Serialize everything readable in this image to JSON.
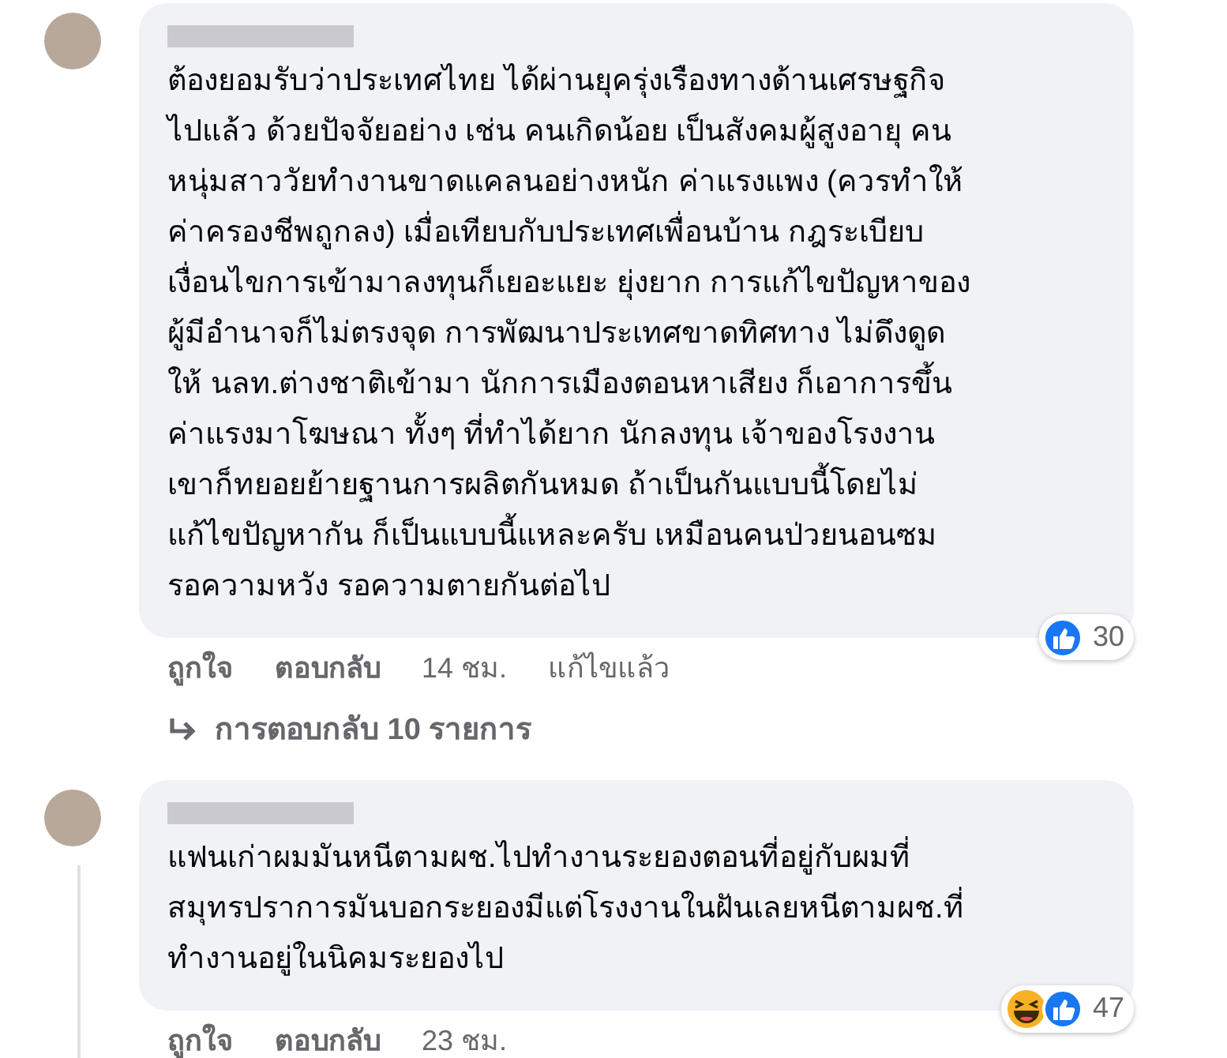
{
  "comments": [
    {
      "text_lines": [
        "ต้องยอมรับว่าประเทศไทย ได้ผ่านยุครุ่งเรืองทางด้านเศรษฐกิจ",
        "ไปแล้ว ด้วยปัจจัยอย่าง เช่น คนเกิดน้อย เป็นสังคมผู้สูงอายุ คน",
        "หนุ่มสาววัยทำงานขาดแคลนอย่างหนัก ค่าแรงแพง (ควรทำให้",
        "ค่าครองชีพถูกลง) เมื่อเทียบกับประเทศเพื่อนบ้าน กฎระเบียบ",
        "เงื่อนไขการเข้ามาลงทุนก็เยอะแยะ ยุ่งยาก การแก้ไขปัญหาของ",
        "ผู้มีอำนาจก็ไม่ตรงจุด การพัฒนาประเทศขาดทิศทาง ไม่ดึงดูด",
        "ให้ นลท.ต่างชาติเข้ามา นักการเมืองตอนหาเสียง ก็เอาการขึ้น",
        "ค่าแรงมาโฆษณา ทั้งๆ ที่ทำได้ยาก นักลงทุน เจ้าของโรงงาน",
        "เขาก็ทยอยย้ายฐานการผลิตกันหมด ถ้าเป็นกันแบบนี้โดยไม่",
        "แก้ไขปัญหากัน ก็เป็นแบบนี้แหละครับ เหมือนคนป่วยนอนซม",
        "รอความหวัง รอความตายกันต่อไป"
      ],
      "reactions": [
        {
          "kind": "like"
        }
      ],
      "reaction_count": "30",
      "actions": [
        "ถูกใจ",
        "ตอบกลับ"
      ],
      "time": "14 ชม.",
      "edited_label": "แก้ไขแล้ว",
      "replies_link": "การตอบกลับ 10 รายการ"
    },
    {
      "text_lines": [
        "แฟนเก่าผมมันหนีตามผช.ไปทำงานระยองตอนที่อยู่กับผมที่",
        "สมุทรปราการมันบอกระยองมีแต่โรงงานในฝันเลยหนีตามผช.ที่",
        "ทำงานอยู่ในนิคมระยองไป"
      ],
      "reactions": [
        {
          "kind": "haha"
        },
        {
          "kind": "like"
        }
      ],
      "reaction_count": "47",
      "actions": [
        "ถูกใจ",
        "ตอบกลับ"
      ],
      "time": "23 ชม."
    }
  ]
}
